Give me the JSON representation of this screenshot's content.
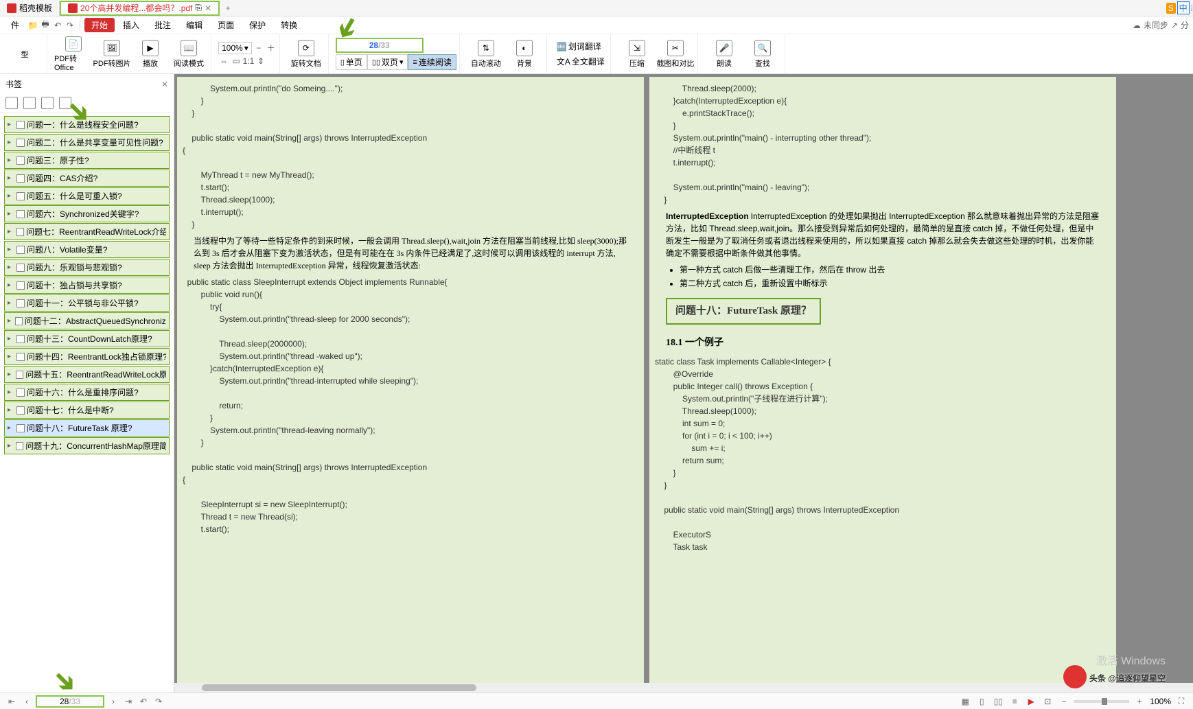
{
  "tabs": {
    "t1": "稻壳模板",
    "t2": "20个高并发编程...都会吗？.pdf"
  },
  "ribbon": {
    "file": "件",
    "start": "开始",
    "insert": "插入",
    "review": "批注",
    "edit": "编辑",
    "page": "页面",
    "protect": "保护",
    "convert": "转换",
    "sync": "未同步",
    "share": "分"
  },
  "tools": {
    "type": "型",
    "pdf_office": "PDF转Office",
    "pdf_img": "PDF转图片",
    "play": "播放",
    "read_mode": "阅读模式",
    "zoom": "100%",
    "rotate": "旋转文档",
    "single": "单页",
    "double": "双页",
    "continuous": "连续阅读",
    "auto_scroll": "自动滚动",
    "background": "背景",
    "word_trans": "划词翻译",
    "full_trans": "全文翻译",
    "compress": "压缩",
    "crop": "截图和对比",
    "speak": "朗读",
    "find": "查找",
    "page_current": "28",
    "page_total": "/33"
  },
  "sidebar": {
    "title": "书签",
    "items": [
      "问题一：什么是线程安全问题?",
      "问题二：什么是共享变量可见性问题?",
      "问题三：原子性?",
      "问题四：CAS介绍?",
      "问题五：什么是可重入锁?",
      "问题六：Synchronized关键字?",
      "问题七：ReentrantReadWriteLock介绍?",
      "问题八：Volatile变量?",
      "问题九：乐观锁与悲观锁?",
      "问题十：独占锁与共享锁?",
      "问题十一：公平锁与非公平锁?",
      "问题十二：AbstractQueuedSynchronizer介绍?",
      "问题十三：CountDownLatch原理?",
      "问题十四：ReentrantLock独占锁原理?",
      "问题十五：ReentrantReadWriteLock原理?",
      "问题十六：什么是重排序问题?",
      "问题十七：什么是中断?",
      "问题十八：FutureTask 原理?",
      "问题十九：ConcurrentHashMap原理简述?"
    ]
  },
  "pageL": {
    "code1": "            System.out.println(\"do Someing....\");\n        }\n    }\n\n    public static void main(String[] args) throws InterruptedException\n{\n\n        MyThread t = new MyThread();\n        t.start();\n        Thread.sleep(1000);\n        t.interrupt();\n    }",
    "prose1": "当线程中为了等待一些特定条件的到来时候，一般会调用 Thread.sleep(),wait,join 方法在阻塞当前线程,比如 sleep(3000);那么到 3s 后才会从阻塞下变为激活状态，但是有可能在在 3s 内条件已经满足了,这时候可以调用该线程的 interrupt 方法, sleep 方法会抛出 InterruptedException 异常，线程恢复激活状态:",
    "code2": "  public static class SleepInterrupt extends Object implements Runnable{\n        public void run(){\n            try{\n                System.out.println(\"thread-sleep for 2000 seconds\");\n\n                Thread.sleep(2000000);\n                System.out.println(\"thread -waked up\");\n            }catch(InterruptedException e){\n                System.out.println(\"thread-interrupted while sleeping\");\n\n                return;\n            }\n            System.out.println(\"thread-leaving normally\");\n        }\n\n    public static void main(String[] args) throws InterruptedException\n{\n\n        SleepInterrupt si = new SleepInterrupt();\n        Thread t = new Thread(si);\n        t.start();"
  },
  "pageR": {
    "code1": "            Thread.sleep(2000);\n        }catch(InterruptedException e){\n            e.printStackTrace();\n        }\n        System.out.println(\"main() - interrupting other thread\");\n        //中断线程 t\n        t.interrupt();\n\n        System.out.println(\"main() - leaving\");\n    }",
    "prose1": "InterruptedException 的处理如果抛出 InterruptedException 那么就意味着抛出异常的方法是阻塞方法，比如 Thread.sleep,wait,join。那么接受到异常后如何处理的，最简单的是直接 catch 掉，不做任何处理，但是中断发生一般是为了取消任务或者退出线程来使用的，所以如果直接 catch 掉那么就会失去做这些处理的时机，出发你能确定不需要根据中断条件做其他事情。",
    "bul1": "第一种方式 catch 后做一些清理工作，然后在 throw 出去",
    "bul2": "第二种方式 catch 后，重新设置中断标示",
    "heading": "问题十八：FutureTask 原理？",
    "sub": "18.1 一个例子",
    "code2": "static class Task implements Callable<Integer> {\n        @Override\n        public Integer call() throws Exception {\n            System.out.println(\"子线程在进行计算\");\n            Thread.sleep(1000);\n            int sum = 0;\n            for (int i = 0; i < 100; i++)\n                sum += i;\n            return sum;\n        }\n    }\n\n    public static void main(String[] args) throws InterruptedException\n\n        ExecutorS\n        Task task"
  },
  "status": {
    "page": "28",
    "total": "/33",
    "zoom": "100%"
  },
  "watermark": "头条 @追逐仰望星空",
  "activation": "激活 Windows"
}
